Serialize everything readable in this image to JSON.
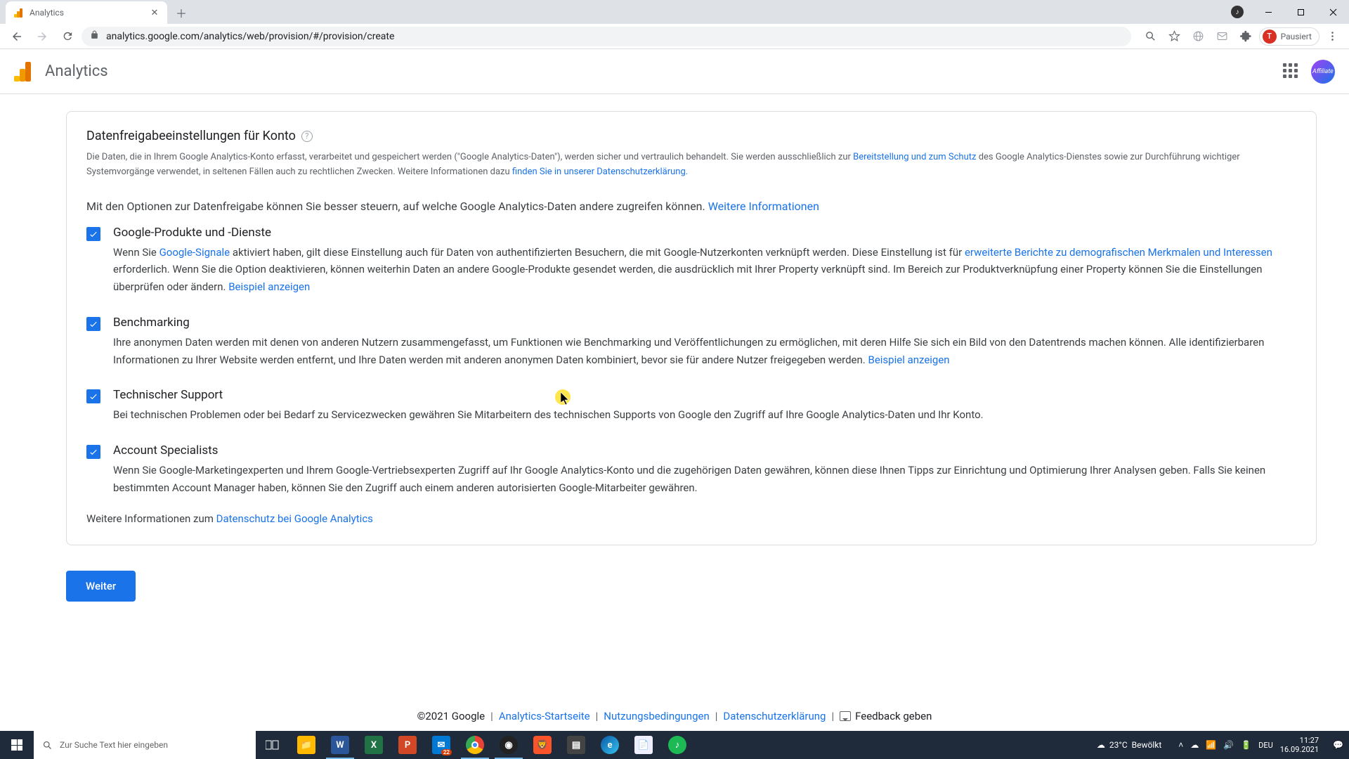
{
  "browser": {
    "tab_title": "Analytics",
    "url": "analytics.google.com/analytics/web/provision/#/provision/create",
    "profile_status": "Pausiert",
    "profile_initial": "T"
  },
  "header": {
    "app_name": "Analytics"
  },
  "card": {
    "title": "Datenfreigabeeinstellungen für Konto",
    "intro_a": "Die Daten, die in Ihrem Google Analytics-Konto erfasst, verarbeitet und gespeichert werden (\"Google Analytics-Daten\"), werden sicher und vertraulich behandelt. Sie werden ausschließlich zur ",
    "intro_link1": "Bereitstellung und zum Schutz",
    "intro_b": " des Google Analytics-Dienstes sowie zur Durchführung wichtiger Systemvorgänge verwendet, in seltenen Fällen auch zu rechtlichen Zwecken. Weitere Informationen dazu ",
    "intro_link2": "finden Sie in unserer Datenschutzerklärung.",
    "subintro": "Mit den Optionen zur Datenfreigabe können Sie besser steuern, auf welche Google Analytics-Daten andere zugreifen können. ",
    "subintro_link": "Weitere Informationen",
    "opt1_title": "Google-Produkte und -Dienste",
    "opt1_a": "Wenn Sie ",
    "opt1_link1": "Google-Signale",
    "opt1_b": " aktiviert haben, gilt diese Einstellung auch für Daten von authentifizierten Besuchern, die mit Google-Nutzerkonten verknüpft werden. Diese Einstellung ist für ",
    "opt1_link2": "erweiterte Berichte zu demografischen Merkmalen und Interessen",
    "opt1_c": " erforderlich. Wenn Sie die Option deaktivieren, können weiterhin Daten an andere Google-Produkte gesendet werden, die ausdrücklich mit Ihrer Property verknüpft sind. Im Bereich zur Produktverknüpfung einer Property können Sie die Einstellungen überprüfen oder ändern.   ",
    "opt1_ex": "Beispiel anzeigen",
    "opt2_title": "Benchmarking",
    "opt2_desc": "Ihre anonymen Daten werden mit denen von anderen Nutzern zusammengefasst, um Funktionen wie Benchmarking und Veröffentlichungen zu ermöglichen, mit deren Hilfe Sie sich ein Bild von den Datentrends machen können. Alle identifizierbaren Informationen zu Ihrer Website werden entfernt, und Ihre Daten werden mit anderen anonymen Daten kombiniert, bevor sie für andere Nutzer freigegeben werden.   ",
    "opt2_ex": "Beispiel anzeigen",
    "opt3_title": "Technischer Support",
    "opt3_desc": "Bei technischen Problemen oder bei Bedarf zu Servicezwecken gewähren Sie Mitarbeitern des technischen Supports von Google den Zugriff auf Ihre Google Analytics-Daten und Ihr Konto.",
    "opt4_title": "Account Specialists",
    "opt4_desc": "Wenn Sie Google-Marketingexperten und Ihrem Google-Vertriebsexperten Zugriff auf Ihr Google Analytics-Konto und die zugehörigen Daten gewähren, können diese Ihnen Tipps zur Einrichtung und Optimierung Ihrer Analysen geben. Falls Sie keinen bestimmten Account Manager haben, können Sie den Zugriff auch einem anderen autorisierten Google-Mitarbeiter gewähren.",
    "footer_a": "Weitere Informationen zum ",
    "footer_link": "Datenschutz bei Google Analytics",
    "next_btn": "Weiter"
  },
  "footer": {
    "copyright": "©2021 Google",
    "link1": "Analytics-Startseite",
    "link2": "Nutzungsbedingungen",
    "link3": "Datenschutzerklärung",
    "feedback": "Feedback geben"
  },
  "taskbar": {
    "search_placeholder": "Zur Suche Text hier eingeben",
    "weather_temp": "23°C",
    "weather_desc": "Bewölkt",
    "lang": "DEU",
    "time": "11:27",
    "date": "16.09.2021"
  }
}
